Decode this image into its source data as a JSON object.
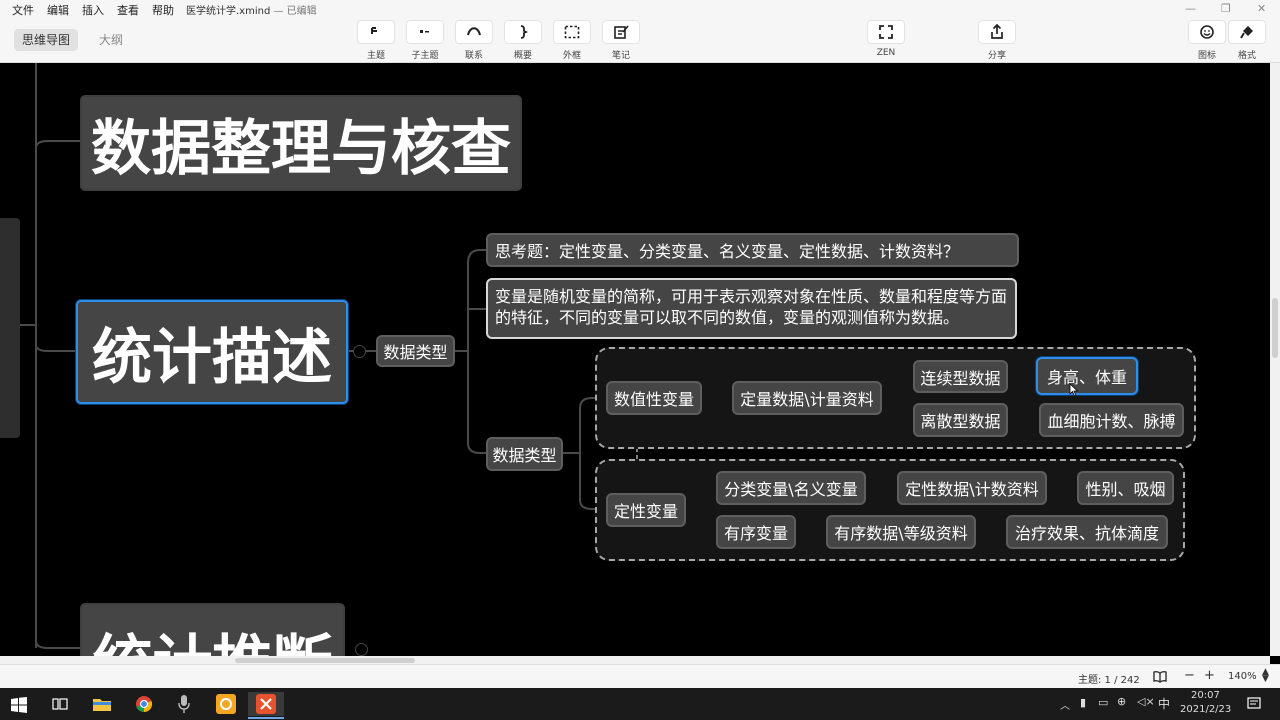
{
  "menu": {
    "items": [
      "文件",
      "编辑",
      "插入",
      "查看",
      "帮助"
    ],
    "doc_title": "医学统计学.xmind",
    "doc_status": "— 已编辑"
  },
  "toolbar": {
    "view_tabs": [
      "思维导图",
      "大纲"
    ],
    "tools": [
      "主题",
      "子主题",
      "联系",
      "概要",
      "外框",
      "笔记"
    ],
    "zen": "ZEN",
    "share": "分享",
    "icon_panel": "图标",
    "format_panel": "格式"
  },
  "mindmap": {
    "topics": {
      "organize": "数据整理与核查",
      "describe": "统计描述",
      "infer": "统计推断"
    },
    "data_type_a": "数据类型",
    "question": "思考题：定性变量、分类变量、名义变量、定性数据、计数资料？",
    "definition": "变量是随机变量的简称，可用于表示观察对象在性质、数量和程度等方面的特征，不同的变量可以取不同的数值，变量的观测值称为数据。",
    "data_type_b": "数据类型",
    "numeric": {
      "label": "数值性变量",
      "quant": "定量数据\\计量资料",
      "continuous": "连续型数据",
      "continuous_ex": "身高、体重",
      "discrete": "离散型数据",
      "discrete_ex": "血细胞计数、脉搏"
    },
    "qualitative": {
      "label": "定性变量",
      "nominal": "分类变量\\名义变量",
      "nominal_data": "定性数据\\计数资料",
      "nominal_ex": "性别、吸烟",
      "ordinal": "有序变量",
      "ordinal_data": "有序数据\\等级资料",
      "ordinal_ex": "治疗效果、抗体滴度"
    }
  },
  "status": {
    "topic_count": "主题: 1 / 242",
    "zoom": "140%"
  },
  "taskbar": {
    "time": "20:07",
    "date": "2021/2/23",
    "ime": "中"
  },
  "colors": {
    "canvas": "#000000",
    "node": "#454545",
    "selection": "#2e8fe8"
  }
}
